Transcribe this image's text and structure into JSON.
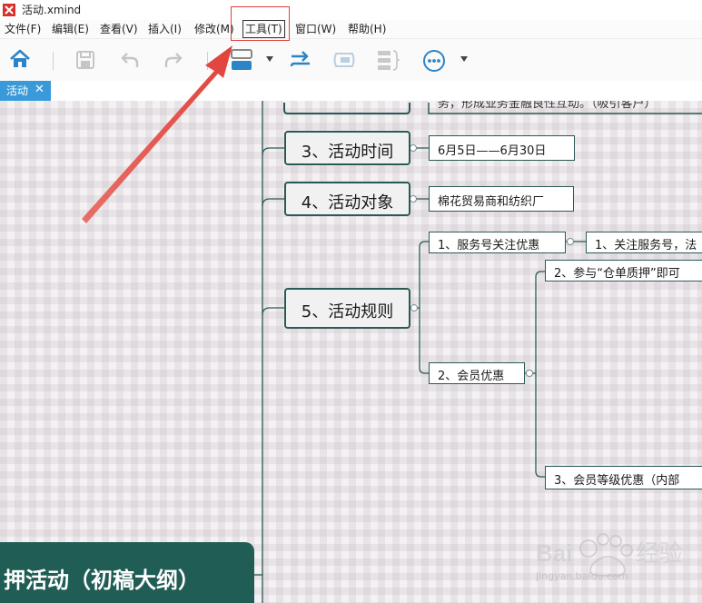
{
  "window": {
    "title": "活动.xmind"
  },
  "menu": [
    {
      "label": "文件(F)"
    },
    {
      "label": "编辑(E)"
    },
    {
      "label": "查看(V)"
    },
    {
      "label": "插入(I)"
    },
    {
      "label": "修改(M)"
    },
    {
      "label": "工具(T)"
    },
    {
      "label": "窗口(W)"
    },
    {
      "label": "帮助(H)"
    }
  ],
  "toolbar": {
    "icons": [
      "home-icon",
      "save-icon",
      "undo-icon",
      "redo-icon",
      "topic-structure-icon",
      "relationship-icon",
      "boundary-icon",
      "summary-icon",
      "more-icon"
    ]
  },
  "tab": {
    "label": "活动",
    "close": "✕"
  },
  "map": {
    "partial_top_text": "务，形成业务金融良性互动。（吸引客户）",
    "topics": [
      {
        "label": "3、活动时间",
        "child": "6月5日——6月30日"
      },
      {
        "label": "4、活动对象",
        "child": "棉花贸易商和纺织厂"
      },
      {
        "label": "5、活动规则"
      }
    ],
    "rules": [
      {
        "label": "1、服务号关注优惠",
        "child": "1、关注服务号，法"
      },
      {
        "label": "2、会员优惠"
      }
    ],
    "member_items": [
      "2、参与“仓单质押”即可",
      "3、会员等级优惠（内部"
    ],
    "central": "押活动（初稿大纲）"
  },
  "watermark": {
    "text": "jingyan.baidu.com"
  },
  "colors": {
    "accent": "#3a9ad9",
    "topic_border": "#2a5a55",
    "central_bg": "#1f5d55",
    "highlight": "#e0413a"
  }
}
